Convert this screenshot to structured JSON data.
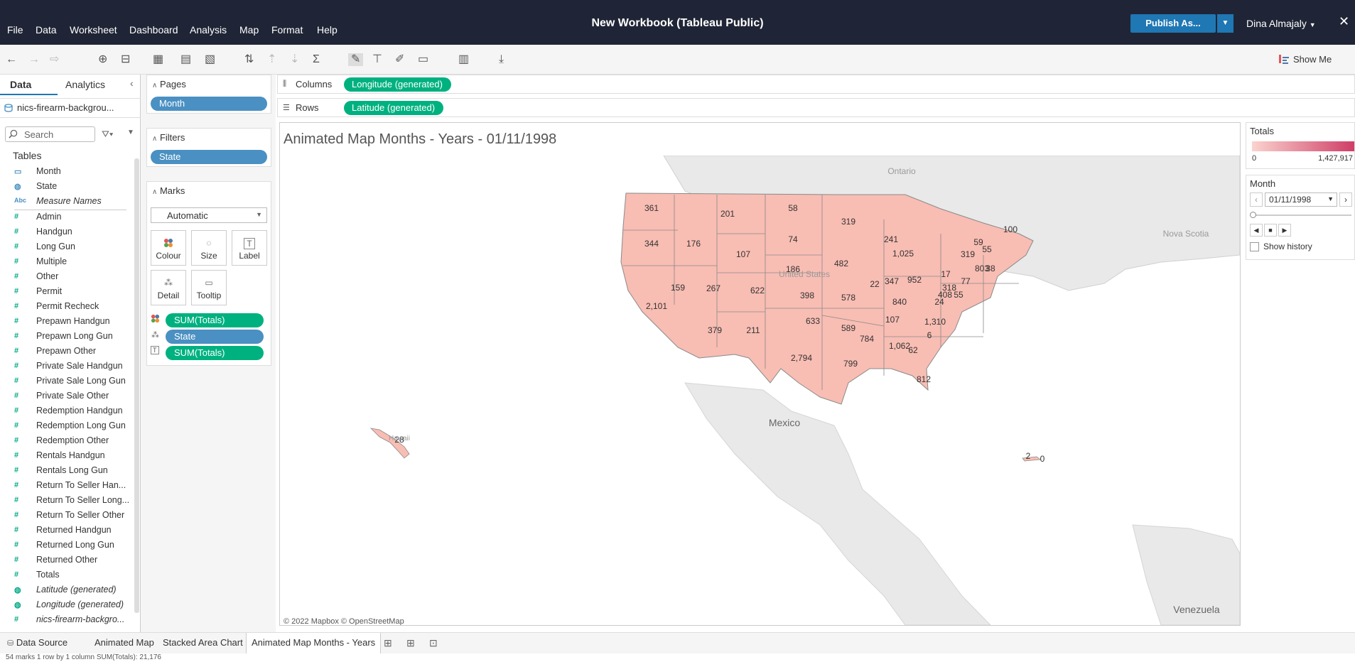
{
  "app": {
    "title": "New Workbook (Tableau Public)",
    "menu": [
      "File",
      "Data",
      "Worksheet",
      "Dashboard",
      "Analysis",
      "Map",
      "Format",
      "Help"
    ],
    "publish_label": "Publish As...",
    "user": "Dina Almajaly",
    "show_me": "Show Me"
  },
  "data_pane": {
    "tab_data": "Data",
    "tab_analytics": "Analytics",
    "datasource": "nics-firearm-backgrou...",
    "search_placeholder": "Search",
    "tables_heading": "Tables",
    "fields": [
      {
        "label": "Month",
        "icon": "calendar-icon",
        "type": "dim"
      },
      {
        "label": "State",
        "icon": "globe-icon",
        "type": "dim"
      },
      {
        "label": "Measure Names",
        "icon": "abc-icon",
        "type": "dim-italic"
      },
      {
        "label": "Admin",
        "icon": "hash-icon",
        "type": "measure"
      },
      {
        "label": "Handgun",
        "icon": "hash-icon",
        "type": "measure"
      },
      {
        "label": "Long Gun",
        "icon": "hash-icon",
        "type": "measure"
      },
      {
        "label": "Multiple",
        "icon": "hash-icon",
        "type": "measure"
      },
      {
        "label": "Other",
        "icon": "hash-icon",
        "type": "measure"
      },
      {
        "label": "Permit",
        "icon": "hash-icon",
        "type": "measure"
      },
      {
        "label": "Permit Recheck",
        "icon": "hash-icon",
        "type": "measure"
      },
      {
        "label": "Prepawn Handgun",
        "icon": "hash-icon",
        "type": "measure"
      },
      {
        "label": "Prepawn Long Gun",
        "icon": "hash-icon",
        "type": "measure"
      },
      {
        "label": "Prepawn Other",
        "icon": "hash-icon",
        "type": "measure"
      },
      {
        "label": "Private Sale Handgun",
        "icon": "hash-icon",
        "type": "measure"
      },
      {
        "label": "Private Sale Long Gun",
        "icon": "hash-icon",
        "type": "measure"
      },
      {
        "label": "Private Sale Other",
        "icon": "hash-icon",
        "type": "measure"
      },
      {
        "label": "Redemption Handgun",
        "icon": "hash-icon",
        "type": "measure"
      },
      {
        "label": "Redemption Long Gun",
        "icon": "hash-icon",
        "type": "measure"
      },
      {
        "label": "Redemption Other",
        "icon": "hash-icon",
        "type": "measure"
      },
      {
        "label": "Rentals Handgun",
        "icon": "hash-icon",
        "type": "measure"
      },
      {
        "label": "Rentals Long Gun",
        "icon": "hash-icon",
        "type": "measure"
      },
      {
        "label": "Return To Seller Han...",
        "icon": "hash-icon",
        "type": "measure"
      },
      {
        "label": "Return To Seller Long...",
        "icon": "hash-icon",
        "type": "measure"
      },
      {
        "label": "Return To Seller Other",
        "icon": "hash-icon",
        "type": "measure"
      },
      {
        "label": "Returned Handgun",
        "icon": "hash-icon",
        "type": "measure"
      },
      {
        "label": "Returned Long Gun",
        "icon": "hash-icon",
        "type": "measure"
      },
      {
        "label": "Returned Other",
        "icon": "hash-icon",
        "type": "measure"
      },
      {
        "label": "Totals",
        "icon": "hash-icon",
        "type": "measure"
      },
      {
        "label": "Latitude (generated)",
        "icon": "globe-icon",
        "type": "measure-italic"
      },
      {
        "label": "Longitude (generated)",
        "icon": "globe-icon",
        "type": "measure-italic"
      },
      {
        "label": "nics-firearm-backgro...",
        "icon": "hash-icon",
        "type": "measure-italic"
      }
    ]
  },
  "cards": {
    "pages_title": "Pages",
    "pages_pill": "Month",
    "filters_title": "Filters",
    "filters_pill": "State",
    "marks_title": "Marks",
    "mark_type": "Automatic",
    "buttons": {
      "colour": "Colour",
      "size": "Size",
      "label": "Label",
      "detail": "Detail",
      "tooltip": "Tooltip"
    },
    "mark_pills": [
      "SUM(Totals)",
      "State",
      "SUM(Totals)"
    ]
  },
  "shelves": {
    "columns_label": "Columns",
    "columns_pill": "Longitude (generated)",
    "rows_label": "Rows",
    "rows_pill": "Latitude (generated)"
  },
  "viz": {
    "title": "Animated Map Months - Years - 01/11/1998",
    "attribution": "© 2022 Mapbox  © OpenStreetMap",
    "place_labels": [
      "Ontario",
      "Nova Scotia",
      "Mexico",
      "Venezuela",
      "Hawaii",
      "United States"
    ],
    "state_values": [
      "361",
      "201",
      "58",
      "319",
      "344",
      "176",
      "74",
      "241",
      "100",
      "59",
      "55",
      "107",
      "186",
      "482",
      "1,025",
      "319",
      "17",
      "77",
      "38",
      "159",
      "267",
      "622",
      "398",
      "578",
      "22",
      "347",
      "952",
      "408",
      "318",
      "55",
      "840",
      "24",
      "803",
      "2,101",
      "633",
      "107",
      "379",
      "211",
      "589",
      "784",
      "1,310",
      "6",
      "1,062",
      "62",
      "2,794",
      "799",
      "812",
      "28",
      "2",
      "0"
    ]
  },
  "legend": {
    "totals_title": "Totals",
    "totals_min": "0",
    "totals_max": "1,427,917",
    "color_low": "#fbd3ce",
    "color_high": "#cf3e67",
    "month_title": "Month",
    "month_value": "01/11/1998",
    "show_history": "Show history"
  },
  "sheet_tabs": [
    "Data Source",
    "Animated Map",
    "Stacked Area Chart",
    "Animated Map Months - Years"
  ],
  "status": "54 marks    1 row by 1 column    SUM(Totals): 21,176",
  "colors": {
    "topbar": "#1f2536",
    "accent": "#1f77b4",
    "pill_green": "#00b180",
    "pill_blue": "#4a90c2",
    "state_fill": "#f8bdb3",
    "land": "#e9e9e9",
    "water": "#ffffff"
  }
}
